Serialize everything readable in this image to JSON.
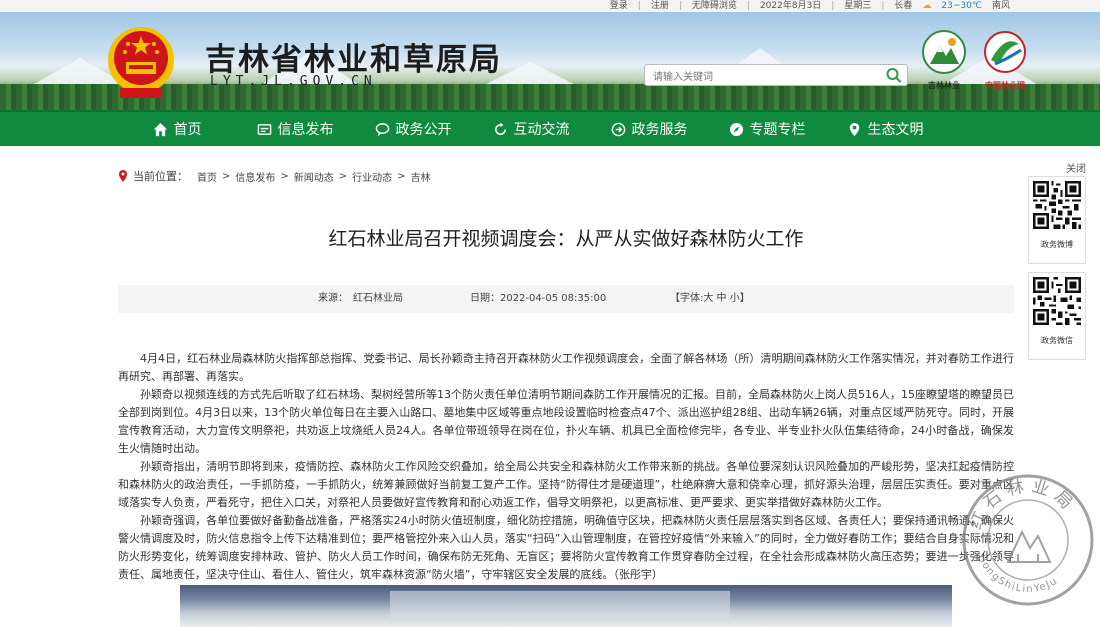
{
  "topbar": {
    "login": "登录",
    "register": "注册",
    "accessible": "无障碍浏览",
    "date": "2022年8月3日",
    "weekday": "星期三",
    "city": "长春",
    "temp": "23~30℃",
    "wind": "南风"
  },
  "header": {
    "title": "吉林省林业和草原局",
    "url": "LYT.JL.GOV.CN",
    "search_placeholder": "请输入关键词",
    "logo1_caption": "吉林林业",
    "logo2_caption": "中国林业网"
  },
  "nav": {
    "items": [
      {
        "label": "首页",
        "icon": "home-icon"
      },
      {
        "label": "信息发布",
        "icon": "info-icon"
      },
      {
        "label": "政务公开",
        "icon": "chat-icon"
      },
      {
        "label": "互动交流",
        "icon": "refresh-icon"
      },
      {
        "label": "政务服务",
        "icon": "login-icon"
      },
      {
        "label": "专题专栏",
        "icon": "compass-icon"
      },
      {
        "label": "生态文明",
        "icon": "pin-icon"
      }
    ]
  },
  "breadcrumb": {
    "label": "当前位置：",
    "items": [
      "首页",
      "信息发布",
      "新闻动态",
      "行业动态",
      "吉林"
    ],
    "sep": ">"
  },
  "article": {
    "title": "红石林业局召开视频调度会：从严从实做好森林防火工作",
    "source": "来源：　红石林业局",
    "date": "日期：2022-04-05 08:35:00",
    "font_size_label": "【字体:大 中 小】",
    "paragraphs": [
      "4月4日，红石林业局森林防火指挥部总指挥、党委书记、局长孙颖奇主持召开森林防火工作视频调度会，全面了解各林场（所）清明期间森林防火工作落实情况，并对春防工作进行再研究、再部署、再落实。",
      "孙颖奇以视频连线的方式先后听取了红石林场、梨树经营所等13个防火责任单位清明节期间森防工作开展情况的汇报。目前，全局森林防火上岗人员516人，15座瞭望塔的瞭望员已全部到岗到位。4月3日以来，13个防火单位每日在主要入山路口、墓地集中区域等重点地段设置临时检查点47个、派出巡护组28组、出动车辆26辆，对重点区域严防死守。同时，开展宣传教育活动，大力宣传文明祭祀，共劝返上坟烧纸人员24人。各单位带班领导在岗在位，扑火车辆、机具已全面检修完毕，各专业、半专业扑火队伍集结待命，24小时备战，确保发生火情随时出动。",
      "孙颖奇指出，清明节即将到来，疫情防控、森林防火工作风险交织叠加，给全局公共安全和森林防火工作带来新的挑战。各单位要深刻认识风险叠加的严峻形势，坚决扛起疫情防控和森林防火的政治责任，一手抓防疫，一手抓防火，统筹兼顾做好当前复工复产工作。坚持“防得住才是硬道理”，杜绝麻痹大意和侥幸心理，抓好源头治理，层层压实责任。要对重点区域落实专人负责，严看死守，把住入口关，对祭祀人员要做好宣传教育和耐心劝返工作，倡导文明祭祀，以更高标准、更严要求、更实举措做好森林防火工作。",
      "孙颖奇强调，各单位要做好备勤备战准备，严格落实24小时防火值班制度，细化防控措施，明确值守区块，把森林防火责任层层落实到各区域、各责任人；要保持通讯畅通，确保火警火情调度及时，防火信息指令上传下达精准到位；要严格管控外来入山人员，落实“扫码”入山管理制度，在管控好疫情“外来输入”的同时，全力做好春防工作；要结合自身实际情况和防火形势变化，统筹调度安排林政、管护、防火人员工作时间，确保布防无死角、无盲区；要将防火宣传教育工作贯穿春防全过程，在全社会形成森林防火高压态势；要进一步强化领导责任、属地责任，坚决守住山、看住人、管住火，筑牢森林资源“防火墙”，守牢辖区安全发展的底线。（张彤宇）"
    ]
  },
  "float": {
    "close": "关闭",
    "qr1_caption": "政务微博",
    "qr2_caption": "政务微信"
  },
  "stamp": {
    "text_top": "红石林业局",
    "text_bottom": "HongShiLinYeJu"
  },
  "colors": {
    "nav_green": "#0f8a3e",
    "emblem_red": "#d0141c",
    "emblem_gold": "#f2c200"
  }
}
